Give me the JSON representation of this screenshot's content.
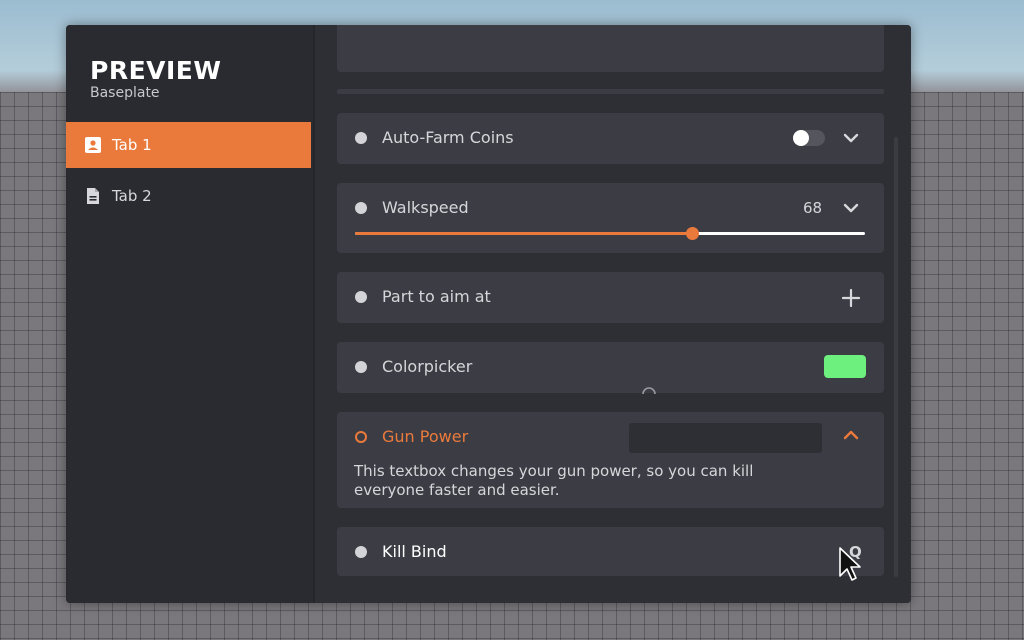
{
  "app": {
    "title": "PREVIEW",
    "subtitle": "Baseplate"
  },
  "tabs": [
    {
      "label": "Tab 1",
      "icon": "contact-card-icon",
      "active": true
    },
    {
      "label": "Tab 2",
      "icon": "document-icon",
      "active": false
    }
  ],
  "elements": {
    "autofarm": {
      "label": "Auto-Farm Coins",
      "toggle_on": false
    },
    "walkspeed": {
      "label": "Walkspeed",
      "value": "68",
      "fill_fraction": 0.66
    },
    "aim_part": {
      "label": "Part to aim at"
    },
    "colorpicker": {
      "label": "Colorpicker",
      "swatch_color": "#6ef07e"
    },
    "gun_power": {
      "label": "Gun Power",
      "description": "This textbox changes your gun power, so you can kill everyone faster and easier.",
      "input_value": ""
    },
    "kill_bind": {
      "label": "Kill Bind",
      "key": "Q"
    }
  },
  "colors": {
    "accent": "#ea7a3b",
    "card": "#3c3d44",
    "sidebar": "#2a2b30"
  }
}
